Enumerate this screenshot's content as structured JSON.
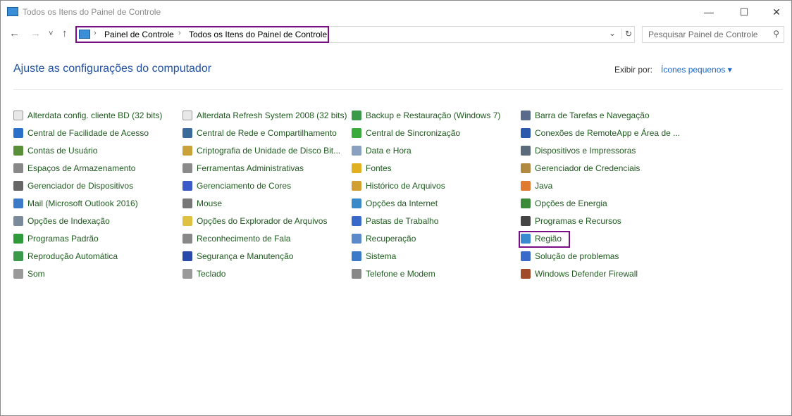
{
  "window": {
    "title": "Todos os Itens do Painel de Controle",
    "minimize": "—",
    "maximize": "☐",
    "close": "✕"
  },
  "nav": {
    "back": "←",
    "forward": "→",
    "recent": "˅",
    "up": "↑",
    "dropdown": "⌄",
    "refresh": "↻"
  },
  "address": {
    "crumbs": [
      "Painel de Controle",
      "Todos os Itens do Painel de Controle"
    ],
    "separator": "›"
  },
  "search": {
    "placeholder": "Pesquisar Painel de Controle",
    "icon": "⚲"
  },
  "header": {
    "title": "Ajuste as configurações do computador",
    "view_by_label": "Exibir por:",
    "view_by_value": "Ícones pequenos ▾"
  },
  "highlight_color": "#7a0f85",
  "columns": [
    [
      {
        "label": "Alterdata config. cliente BD (32 bits)",
        "color": "#e8e8e8"
      },
      {
        "label": "Central de Facilidade de Acesso",
        "color": "#2a6fc9"
      },
      {
        "label": "Contas de Usuário",
        "color": "#5a8f3a"
      },
      {
        "label": "Espaços de Armazenamento",
        "color": "#888888"
      },
      {
        "label": "Gerenciador de Dispositivos",
        "color": "#666666"
      },
      {
        "label": "Mail (Microsoft Outlook 2016)",
        "color": "#3a7ac9"
      },
      {
        "label": "Opções de Indexação",
        "color": "#7a8a9a"
      },
      {
        "label": "Programas Padrão",
        "color": "#2e9a3a"
      },
      {
        "label": "Reprodução Automática",
        "color": "#3a9a4a"
      },
      {
        "label": "Som",
        "color": "#999999"
      }
    ],
    [
      {
        "label": "Alterdata Refresh System 2008 (32 bits)",
        "color": "#e8e8e8"
      },
      {
        "label": "Central de Rede e Compartilhamento",
        "color": "#3a6a9a"
      },
      {
        "label": "Criptografia de Unidade de Disco Bit...",
        "color": "#c9a23a"
      },
      {
        "label": "Ferramentas Administrativas",
        "color": "#8a8a8a"
      },
      {
        "label": "Gerenciamento de Cores",
        "color": "#3a5ac9"
      },
      {
        "label": "Mouse",
        "color": "#777777"
      },
      {
        "label": "Opções do Explorador de Arquivos",
        "color": "#e0c040"
      },
      {
        "label": "Reconhecimento de Fala",
        "color": "#888888"
      },
      {
        "label": "Segurança e Manutenção",
        "color": "#2a4aa9"
      },
      {
        "label": "Teclado",
        "color": "#999999"
      }
    ],
    [
      {
        "label": "Backup e Restauração (Windows 7)",
        "color": "#3a9a4a"
      },
      {
        "label": "Central de Sincronização",
        "color": "#3aaa3a"
      },
      {
        "label": "Data e Hora",
        "color": "#8aa0c0"
      },
      {
        "label": "Fontes",
        "color": "#e0b020"
      },
      {
        "label": "Histórico de Arquivos",
        "color": "#d0a030"
      },
      {
        "label": "Opções da Internet",
        "color": "#3a8ac9"
      },
      {
        "label": "Pastas de Trabalho",
        "color": "#3a6ac9"
      },
      {
        "label": "Recuperação",
        "color": "#5a8ac9"
      },
      {
        "label": "Sistema",
        "color": "#3a7ac9"
      },
      {
        "label": "Telefone e Modem",
        "color": "#888888"
      }
    ],
    [
      {
        "label": "Barra de Tarefas e Navegação",
        "color": "#5a6a8a"
      },
      {
        "label": "Conexões de RemoteApp e Área de ...",
        "color": "#2a5aa9"
      },
      {
        "label": "Dispositivos e Impressoras",
        "color": "#5a6a7a"
      },
      {
        "label": "Gerenciador de Credenciais",
        "color": "#b08a40"
      },
      {
        "label": "Java",
        "color": "#e07a30"
      },
      {
        "label": "Opções de Energia",
        "color": "#3a8a3a"
      },
      {
        "label": "Programas e Recursos",
        "color": "#444444"
      },
      {
        "label": "Região",
        "color": "#3a8ad0"
      },
      {
        "label": "Solução de problemas",
        "color": "#3a6ac9"
      },
      {
        "label": "Windows Defender Firewall",
        "color": "#a04a2a"
      }
    ]
  ]
}
